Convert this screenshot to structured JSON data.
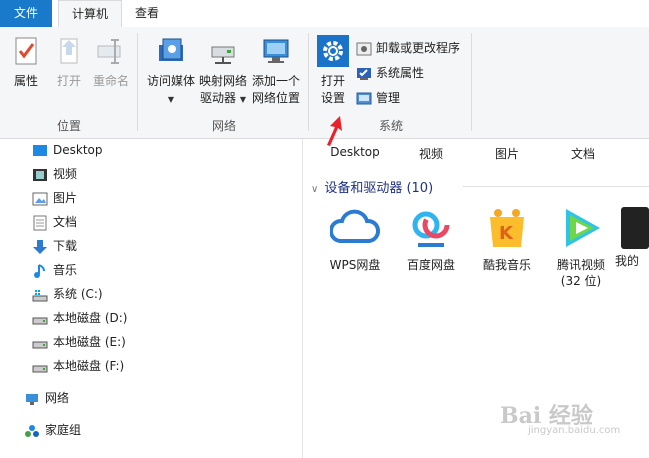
{
  "tabs": {
    "file": "文件",
    "computer": "计算机",
    "view": "查看"
  },
  "ribbon": {
    "location": {
      "label": "位置",
      "properties": "属性",
      "open": "打开",
      "rename": "重命名"
    },
    "network": {
      "label": "网络",
      "access_media": "访问媒体",
      "map_drive_1": "映射网络",
      "map_drive_2": "驱动器",
      "add_location_1": "添加一个",
      "add_location_2": "网络位置"
    },
    "system": {
      "label": "系统",
      "open_settings_1": "打开",
      "open_settings_2": "设置",
      "uninstall": "卸载或更改程序",
      "system_properties": "系统属性",
      "manage": "管理"
    }
  },
  "nav": {
    "items": [
      {
        "label": "Desktop",
        "icon": "desktop-icon"
      },
      {
        "label": "视频",
        "icon": "video-icon"
      },
      {
        "label": "图片",
        "icon": "picture-icon"
      },
      {
        "label": "文档",
        "icon": "document-icon"
      },
      {
        "label": "下载",
        "icon": "download-icon"
      },
      {
        "label": "音乐",
        "icon": "music-icon"
      },
      {
        "label": "系统 (C:)",
        "icon": "system-drive-icon"
      },
      {
        "label": "本地磁盘 (D:)",
        "icon": "drive-icon"
      },
      {
        "label": "本地磁盘 (E:)",
        "icon": "drive-icon"
      },
      {
        "label": "本地磁盘 (F:)",
        "icon": "drive-icon"
      }
    ],
    "network": "网络",
    "homegroup": "家庭组"
  },
  "content": {
    "folders": [
      "Desktop",
      "视频",
      "图片",
      "文档"
    ],
    "section_title": "设备和驱动器 (10)",
    "apps": [
      {
        "line1": "WPS网盘",
        "line2": ""
      },
      {
        "line1": "百度网盘",
        "line2": ""
      },
      {
        "line1": "酷我音乐",
        "line2": ""
      },
      {
        "line1": "腾讯视频",
        "line2": "(32 位)"
      },
      {
        "line1": "我的",
        "line2": ""
      }
    ]
  },
  "watermark": {
    "main": "Bai 经验",
    "sub": "jingyan.baidu.com"
  },
  "colors": {
    "accent": "#1979ca",
    "annotation_arrow": "#e8222a"
  }
}
